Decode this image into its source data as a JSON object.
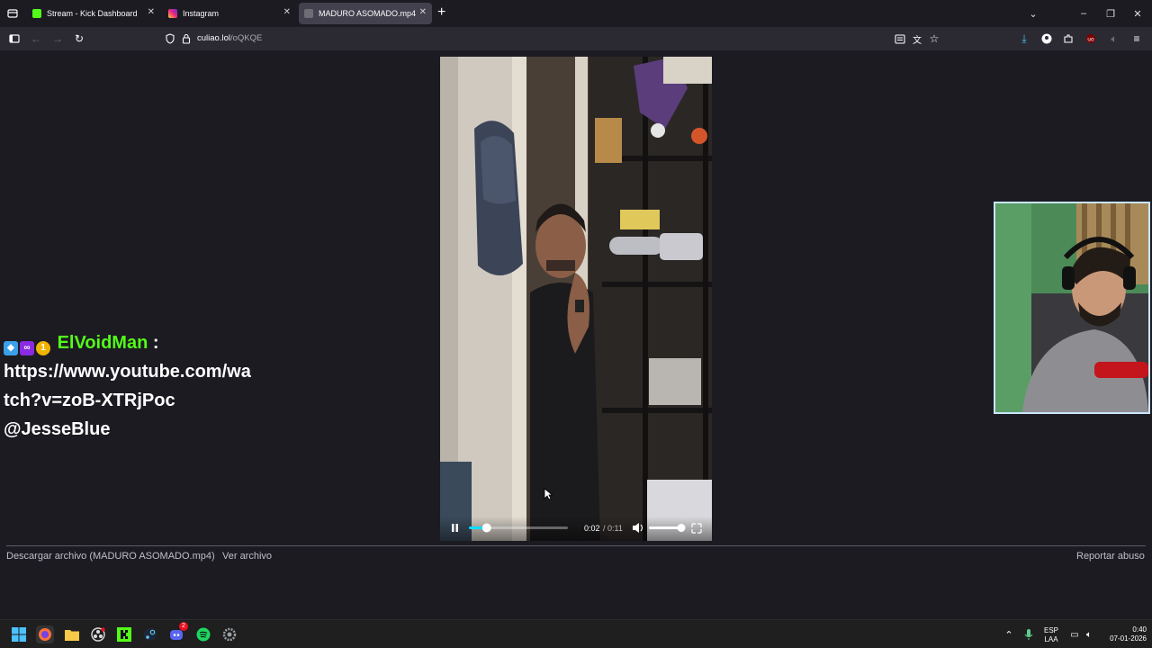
{
  "tabs": [
    {
      "label": "Stream - Kick Dashboard",
      "favicon_color": "#53fc18"
    },
    {
      "label": "Instagram",
      "favicon_color": "#d6249f"
    },
    {
      "label": "MADURO ASOMADO.mp4",
      "favicon_color": "#9e9ea6",
      "active": true
    }
  ],
  "url": {
    "host": "culiao.lol",
    "path": "/oQKQE"
  },
  "chat": {
    "username": "ElVoidMan",
    "separator": ":",
    "message_line1": "https://www.youtube.com/wa",
    "message_line2": "tch?v=zoB-XTRjPoc",
    "message_line3": "@JesseBlue",
    "badges": [
      "cube-badge-icon",
      "os-badge-icon",
      "one-badge-icon"
    ]
  },
  "video": {
    "current_time": "0:02",
    "time_separator": "/",
    "duration": "0:11",
    "progress_fraction": 0.18,
    "volume_fraction": 0.9
  },
  "footer": {
    "download": "Descargar archivo (MADURO ASOMADO.mp4)",
    "view": "Ver archivo",
    "report": "Reportar abuso"
  },
  "taskbar": {
    "lang_line1": "ESP",
    "lang_line2": "LAA",
    "time": "0:40",
    "date": "07-01-2026",
    "discord_badge": "2"
  },
  "colors": {
    "accent_kick": "#53fc18",
    "page_bg": "#1c1b22",
    "navbar_bg": "#2b2a33"
  }
}
